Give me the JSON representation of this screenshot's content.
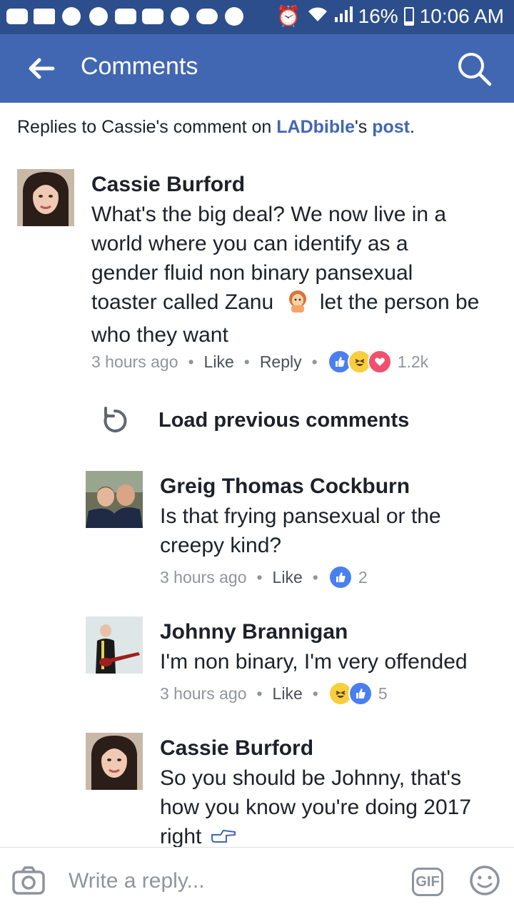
{
  "status_bar": {
    "battery": "16%",
    "battery_level": 0.16,
    "time": "10:06 AM"
  },
  "header": {
    "title": "Comments",
    "back_icon": "arrow-left-icon",
    "search_icon": "search-icon"
  },
  "context": {
    "prefix": "Replies to Cassie's comment on ",
    "page": "LADbible",
    "possessive": "'s ",
    "post": "post",
    "suffix": "."
  },
  "main_comment": {
    "author": "Cassie Burford",
    "lines": [
      "What's the big deal? We now live in a",
      "world where you can identify as a",
      "gender fluid non binary pansexual",
      "toaster called Zanu",
      "let the person be",
      "who they want"
    ],
    "time": "3 hours ago",
    "like": "Like",
    "reply": "Reply",
    "reaction_count": "1.2k"
  },
  "load_previous": "Load previous comments",
  "replies": [
    {
      "author": "Greig Thomas Cockburn",
      "lines": [
        "Is that frying pansexual or the",
        "creepy kind?"
      ],
      "time": "3 hours ago",
      "like": "Like",
      "reaction_count": "2"
    },
    {
      "author": "Johnny Brannigan",
      "lines": [
        "I'm non binary, I'm very offended"
      ],
      "time": "3 hours ago",
      "like": "Like",
      "reaction_count": "5"
    },
    {
      "author": "Cassie Burford",
      "lines": [
        "So you should be Johnny, that's",
        "how you know you're doing 2017",
        "right"
      ],
      "time": "",
      "like": ""
    }
  ],
  "composer": {
    "placeholder": "Write a reply...",
    "gif": "GIF"
  },
  "colors": {
    "status_bar": "#2c4e8c",
    "app_bar": "#4267b2",
    "link": "#4267b2",
    "meta_text": "#90949c"
  }
}
